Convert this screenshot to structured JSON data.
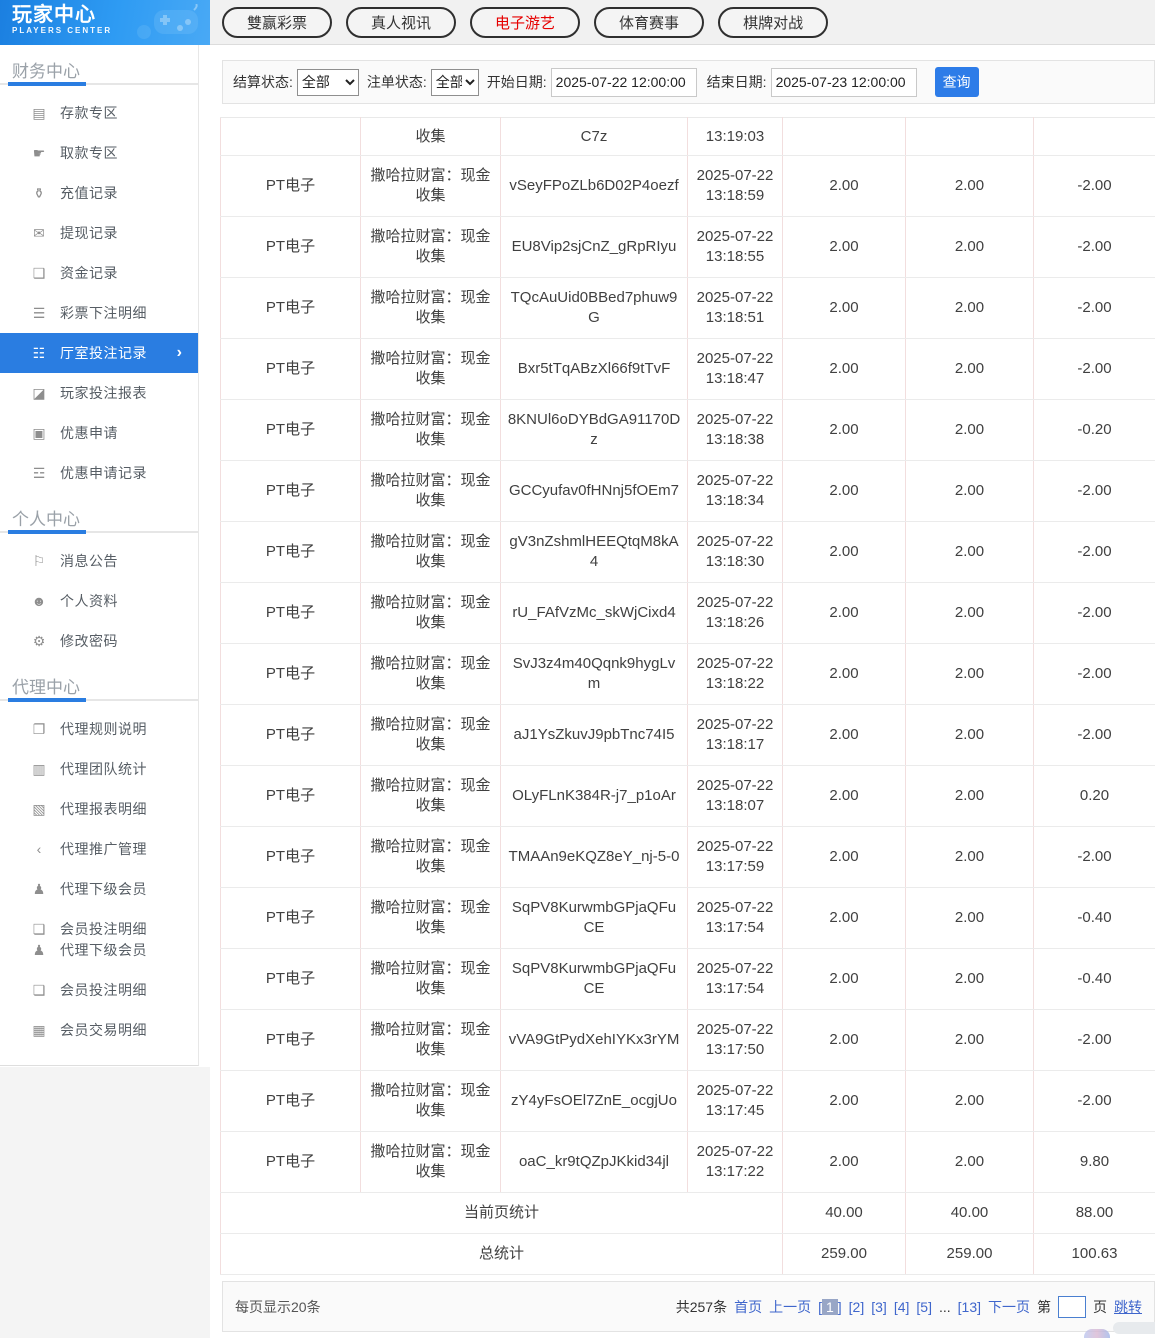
{
  "logo": {
    "title": "玩家中心",
    "subtitle": "PLAYERS CENTER"
  },
  "icon_glyphs": {
    "deposit-card": "▤",
    "withdraw-hand": "☛",
    "recharge-bag": "⚱",
    "wallet": "✉",
    "purse": "❑",
    "lottery-doc": "☰",
    "hall-record": "☷",
    "player-report": "◪",
    "promo-gift": "▣",
    "promo-list": "☲",
    "bell": "⚐",
    "user": "☻",
    "gear": "⚙",
    "rule-doc": "❐",
    "team-news": "▥",
    "report-news": "▧",
    "share": "‹",
    "members": "♟",
    "clipboard": "❏",
    "trans-list": "▦",
    "chevron": "›"
  },
  "sidebar": {
    "sections": [
      {
        "title": "财务中心",
        "items": [
          {
            "icon": "deposit-card",
            "label": "存款专区"
          },
          {
            "icon": "withdraw-hand",
            "label": "取款专区"
          },
          {
            "icon": "recharge-bag",
            "label": "充值记录"
          },
          {
            "icon": "wallet",
            "label": "提现记录"
          },
          {
            "icon": "purse",
            "label": "资金记录"
          },
          {
            "icon": "lottery-doc",
            "label": "彩票下注明细"
          },
          {
            "icon": "hall-record",
            "label": "厅室投注记录",
            "active": true
          },
          {
            "icon": "player-report",
            "label": "玩家投注报表"
          },
          {
            "icon": "promo-gift",
            "label": "优惠申请"
          },
          {
            "icon": "promo-list",
            "label": "优惠申请记录"
          }
        ]
      },
      {
        "title": "个人中心",
        "items": [
          {
            "icon": "bell",
            "label": "消息公告"
          },
          {
            "icon": "user",
            "label": "个人资料"
          },
          {
            "icon": "gear",
            "label": "修改密码"
          }
        ]
      },
      {
        "title": "代理中心",
        "items": [
          {
            "icon": "rule-doc",
            "label": "代理规则说明"
          },
          {
            "icon": "team-news",
            "label": "代理团队统计"
          },
          {
            "icon": "report-news",
            "label": "代理报表明细"
          },
          {
            "icon": "share",
            "label": "代理推广管理"
          },
          {
            "icon": "members",
            "label": "代理下级会员"
          },
          {
            "icon": "clipboard",
            "label": "会员投注明细"
          },
          {
            "icon": "members",
            "label": "代理下级会员",
            "tight": true
          },
          {
            "icon": "clipboard",
            "label": "会员投注明细"
          },
          {
            "icon": "trans-list",
            "label": "会员交易明细"
          }
        ]
      }
    ]
  },
  "tabs": [
    {
      "label": "雙赢彩票"
    },
    {
      "label": "真人视讯"
    },
    {
      "label": "电子游艺",
      "active": true
    },
    {
      "label": "体育赛事"
    },
    {
      "label": "棋牌对战"
    }
  ],
  "filter": {
    "settle_label": "结算状态:",
    "settle_value": "全部",
    "order_label": "注单状态:",
    "order_value": "全部",
    "start_label": "开始日期:",
    "start_value": "2025-07-22 12:00:00",
    "end_label": "结束日期:",
    "end_value": "2025-07-23 12:00:00",
    "query_label": "查询"
  },
  "table": {
    "partial_row": {
      "game": "",
      "name": "收集",
      "order": "C7z",
      "time": "13:19:03",
      "bet": "",
      "valid": "",
      "profit": ""
    },
    "rows": [
      {
        "game": "PT电子",
        "name": "撒哈拉财富：现金收集",
        "order": "vSeyFPoZLb6D02P4oezf",
        "time": "2025-07-22 13:18:59",
        "bet": "2.00",
        "valid": "2.00",
        "profit": "-2.00"
      },
      {
        "game": "PT电子",
        "name": "撒哈拉财富：现金收集",
        "order": "EU8Vip2sjCnZ_gRpRIyu",
        "time": "2025-07-22 13:18:55",
        "bet": "2.00",
        "valid": "2.00",
        "profit": "-2.00"
      },
      {
        "game": "PT电子",
        "name": "撒哈拉财富：现金收集",
        "order": "TQcAuUid0BBed7phuw9G",
        "time": "2025-07-22 13:18:51",
        "bet": "2.00",
        "valid": "2.00",
        "profit": "-2.00"
      },
      {
        "game": "PT电子",
        "name": "撒哈拉财富：现金收集",
        "order": "Bxr5tTqABzXl66f9tTvF",
        "time": "2025-07-22 13:18:47",
        "bet": "2.00",
        "valid": "2.00",
        "profit": "-2.00"
      },
      {
        "game": "PT电子",
        "name": "撒哈拉财富：现金收集",
        "order": "8KNUl6oDYBdGA91170Dz",
        "time": "2025-07-22 13:18:38",
        "bet": "2.00",
        "valid": "2.00",
        "profit": "-0.20"
      },
      {
        "game": "PT电子",
        "name": "撒哈拉财富：现金收集",
        "order": "GCCyufav0fHNnj5fOEm7",
        "time": "2025-07-22 13:18:34",
        "bet": "2.00",
        "valid": "2.00",
        "profit": "-2.00"
      },
      {
        "game": "PT电子",
        "name": "撒哈拉财富：现金收集",
        "order": "gV3nZshmlHEEQtqM8kA4",
        "time": "2025-07-22 13:18:30",
        "bet": "2.00",
        "valid": "2.00",
        "profit": "-2.00"
      },
      {
        "game": "PT电子",
        "name": "撒哈拉财富：现金收集",
        "order": "rU_FAfVzMc_skWjCixd4",
        "time": "2025-07-22 13:18:26",
        "bet": "2.00",
        "valid": "2.00",
        "profit": "-2.00"
      },
      {
        "game": "PT电子",
        "name": "撒哈拉财富：现金收集",
        "order": "SvJ3z4m40Qqnk9hygLvm",
        "time": "2025-07-22 13:18:22",
        "bet": "2.00",
        "valid": "2.00",
        "profit": "-2.00"
      },
      {
        "game": "PT电子",
        "name": "撒哈拉财富：现金收集",
        "order": "aJ1YsZkuvJ9pbTnc74I5",
        "time": "2025-07-22 13:18:17",
        "bet": "2.00",
        "valid": "2.00",
        "profit": "-2.00"
      },
      {
        "game": "PT电子",
        "name": "撒哈拉财富：现金收集",
        "order": "OLyFLnK384R-j7_p1oAr",
        "time": "2025-07-22 13:18:07",
        "bet": "2.00",
        "valid": "2.00",
        "profit": "0.20"
      },
      {
        "game": "PT电子",
        "name": "撒哈拉财富：现金收集",
        "order": "TMAAn9eKQZ8eY_nj-5-0",
        "time": "2025-07-22 13:17:59",
        "bet": "2.00",
        "valid": "2.00",
        "profit": "-2.00"
      },
      {
        "game": "PT电子",
        "name": "撒哈拉财富：现金收集",
        "order": "SqPV8KurwmbGPjaQFuCE",
        "time": "2025-07-22 13:17:54",
        "bet": "2.00",
        "valid": "2.00",
        "profit": "-0.40"
      },
      {
        "game": "PT电子",
        "name": "撒哈拉财富：现金收集",
        "order": "SqPV8KurwmbGPjaQFuCE",
        "time": "2025-07-22 13:17:54",
        "bet": "2.00",
        "valid": "2.00",
        "profit": "-0.40"
      },
      {
        "game": "PT电子",
        "name": "撒哈拉财富：现金收集",
        "order": "vVA9GtPydXehIYKx3rYM",
        "time": "2025-07-22 13:17:50",
        "bet": "2.00",
        "valid": "2.00",
        "profit": "-2.00"
      },
      {
        "game": "PT电子",
        "name": "撒哈拉财富：现金收集",
        "order": "zY4yFsOEl7ZnE_ocgjUo",
        "time": "2025-07-22 13:17:45",
        "bet": "2.00",
        "valid": "2.00",
        "profit": "-2.00"
      },
      {
        "game": "PT电子",
        "name": "撒哈拉财富：现金收集",
        "order": "oaC_kr9tQZpJKkid34jl",
        "time": "2025-07-22 13:17:22",
        "bet": "2.00",
        "valid": "2.00",
        "profit": "9.80"
      }
    ],
    "page_total": {
      "label": "当前页统计",
      "bet": "40.00",
      "valid": "40.00",
      "profit": "88.00"
    },
    "grand_total": {
      "label": "总统计",
      "bet": "259.00",
      "valid": "259.00",
      "profit": "100.63"
    }
  },
  "pagination": {
    "per_page": "每页显示20条",
    "total": "共257条",
    "first": "首页",
    "prev": "上一页",
    "pages": [
      {
        "n": "1",
        "current": true
      },
      {
        "n": "2"
      },
      {
        "n": "3"
      },
      {
        "n": "4"
      },
      {
        "n": "5"
      }
    ],
    "ellipsis": "...",
    "last_page": {
      "n": "13"
    },
    "next": "下一页",
    "bracket_l": "[",
    "bracket_r": "]",
    "jump_prefix": "第",
    "jump_suffix": "页",
    "jump_action": "跳转",
    "jump_value": ""
  },
  "colors": {
    "accent_blue": "#2a7de1",
    "link_blue": "#3f66cc",
    "active_red": "#e60000"
  }
}
